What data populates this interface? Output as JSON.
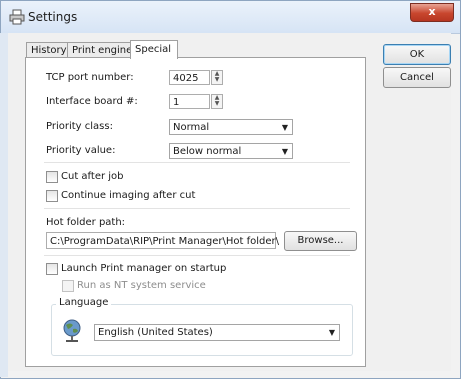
{
  "window": {
    "title": "Settings",
    "close_glyph": "x"
  },
  "tabs": [
    {
      "label": "History",
      "active": false
    },
    {
      "label": "Print engine",
      "active": false
    },
    {
      "label": "Special",
      "active": true
    }
  ],
  "buttons": {
    "ok": "OK",
    "cancel": "Cancel",
    "browse": "Browse..."
  },
  "special": {
    "tcp_port": {
      "label": "TCP port number:",
      "value": "4025"
    },
    "interface_board": {
      "label": "Interface board #:",
      "value": "1"
    },
    "priority_class": {
      "label": "Priority class:",
      "value": "Normal"
    },
    "priority_value": {
      "label": "Priority value:",
      "value": "Below normal"
    },
    "cut_after_job": {
      "label": "Cut after job",
      "checked": false
    },
    "continue_imaging": {
      "label": "Continue imaging after cut",
      "checked": false
    },
    "hot_folder": {
      "label": "Hot folder path:",
      "value": "C:\\ProgramData\\RIP\\Print Manager\\Hot folder\\"
    },
    "launch_on_startup": {
      "label": "Launch Print manager on startup",
      "checked": false
    },
    "run_as_service": {
      "label": "Run as NT system service",
      "checked": false,
      "enabled": false
    },
    "language": {
      "group_label": "Language",
      "value": "English (United States)"
    }
  },
  "icons": {
    "title": "printer-icon",
    "language": "globe-icon",
    "dropdown": "chevron-down-icon",
    "spin_up": "▲",
    "spin_down": "▼",
    "combo_arrow": "▼"
  }
}
